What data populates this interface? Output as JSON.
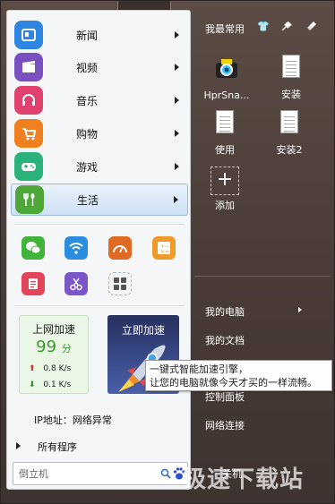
{
  "categories": [
    {
      "label": "新闻",
      "icon": "news-icon",
      "color": "#2f86e0"
    },
    {
      "label": "视频",
      "icon": "film-clapper-icon",
      "color": "#7a4fc0"
    },
    {
      "label": "音乐",
      "icon": "headphones-icon",
      "color": "#e0416e"
    },
    {
      "label": "购物",
      "icon": "shopping-cart-icon",
      "color": "#f07f1f"
    },
    {
      "label": "游戏",
      "icon": "gamepad-icon",
      "color": "#2bb27a"
    },
    {
      "label": "生活",
      "icon": "fork-spoon-icon",
      "color": "#4fa73a",
      "active": true
    }
  ],
  "apps": [
    {
      "icon": "wechat-icon",
      "color": "#3fb33a"
    },
    {
      "icon": "wifi-icon",
      "color": "#2a8de0"
    },
    {
      "icon": "speedometer-icon",
      "color": "#e06a24"
    },
    {
      "icon": "calculator-icon",
      "color": "#f09a2a"
    },
    {
      "icon": "notes-icon",
      "color": "#e0455a"
    },
    {
      "icon": "scissors-icon",
      "color": "#7a56c8"
    },
    {
      "icon": "grid-apps-icon",
      "color": "#555555"
    }
  ],
  "speed": {
    "title": "上网加速",
    "score": "99",
    "score_unit": "分",
    "up": "0.8 K/s",
    "down": "0.1 K/s"
  },
  "boost": {
    "label": "立即加速"
  },
  "ip_text": "IP地址：网络异常",
  "all_programs": "所有程序",
  "search": {
    "placeholder": "倒立机"
  },
  "right": {
    "title": "我最常用",
    "shortcuts": [
      {
        "label": "HprSna...",
        "icon": "camera-app-icon"
      },
      {
        "label": "安装",
        "icon": "document-icon"
      },
      {
        "label": "使用",
        "icon": "document-icon"
      },
      {
        "label": "安装2",
        "icon": "document-icon"
      }
    ],
    "add_label": "添加",
    "nav": [
      {
        "label": "我的电脑",
        "has_arrow": true
      },
      {
        "label": "我的文档",
        "has_arrow": false
      },
      {
        "label": "控制面板",
        "has_arrow": false
      },
      {
        "label": "网络连接",
        "has_arrow": false
      }
    ],
    "shutdown_label": "关机"
  },
  "tooltip": {
    "line1": "一键式智能加速引擎，",
    "line2": "让您的电脑就像今天才买的一样流畅。"
  },
  "watermark": "极速下载站"
}
